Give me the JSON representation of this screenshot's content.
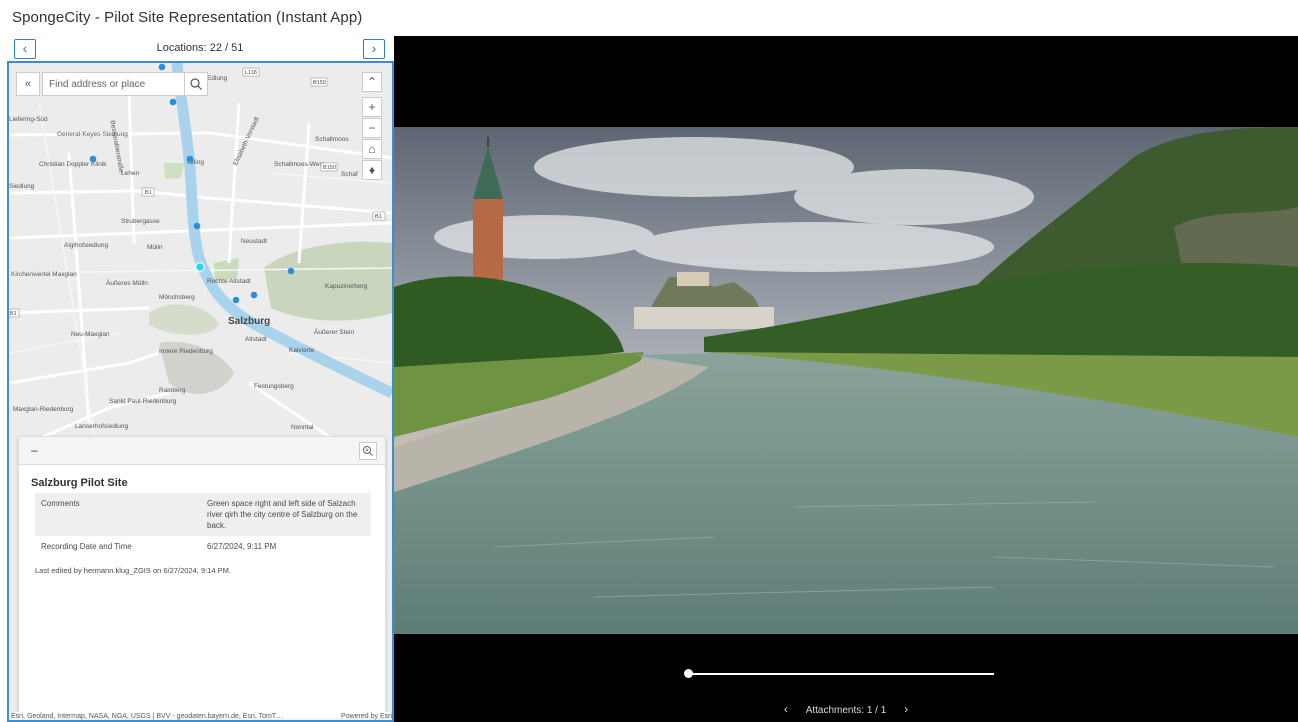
{
  "app": {
    "title": "SpongeCity - Pilot Site Representation (Instant App)"
  },
  "locations": {
    "label": "Locations: 22 / 51",
    "prev_icon": "‹",
    "next_icon": "›"
  },
  "search": {
    "placeholder": "Find address or place",
    "collapse_icon": "«"
  },
  "map_tools": {
    "expand": "⌃",
    "zoom_in": "+",
    "zoom_out": "−",
    "home": "⌂",
    "compass": "♦"
  },
  "map_labels": [
    "Liefering-Süd",
    "General-Keyes-Siedlung",
    "Christian Doppler Klinik",
    "Lehen",
    "Siedlung",
    "Aiglhofsiedlung",
    "Mülln",
    "Kirchenviertel Maxglan",
    "Äußeres Mülln",
    "Mönchsberg",
    "Neustadt",
    "Rechte Altstadt",
    "Salzburg",
    "Altstadt",
    "Äußerer Stein",
    "Kaivierte",
    "Kapuzinerberg",
    "Schallmoos",
    "Schallmoos-West",
    "Itzling",
    "Elisabeth-Vorstadt",
    "Neu-Maxglan",
    "Innere Riedenburg",
    "Rainberg",
    "Festungsberg",
    "Sankt Paul-Riedenburg",
    "Maxglan-Riedenburg",
    "Lanserhofsiedlung",
    "Nonntal",
    "Strubergasse",
    "Schaf",
    "Edlung",
    "Bessarabierstraße",
    "B1",
    "B150",
    "L118"
  ],
  "popup": {
    "dash": "–",
    "title": "Salzburg Pilot Site",
    "rows": [
      {
        "key": "Comments",
        "value": "Green space right and left side of Salzach river qirh the city centre of Salzburg on the back."
      },
      {
        "key": "Recording Date and Time",
        "value": "6/27/2024, 9:11 PM"
      }
    ],
    "edited": "Last edited by hermann.klug_ZGIS on 6/27/2024, 9:14 PM."
  },
  "attribution": {
    "text": "Esri, Geoland, Intermap, NASA, NGA, USGS | BVV - geodaten.bayern.de, Esri, TomT…",
    "powered": "Powered by Esri"
  },
  "media": {
    "attachments_label": "Attachments: 1 / 1",
    "prev_icon": "‹",
    "next_icon": "›",
    "slider_position": 0.0
  },
  "colors": {
    "accent": "#2e7fb8",
    "frame": "#3b8fd1",
    "river": "#9ccbe8",
    "point": "#2b8fd6",
    "selected_point": "#27d4f0"
  }
}
